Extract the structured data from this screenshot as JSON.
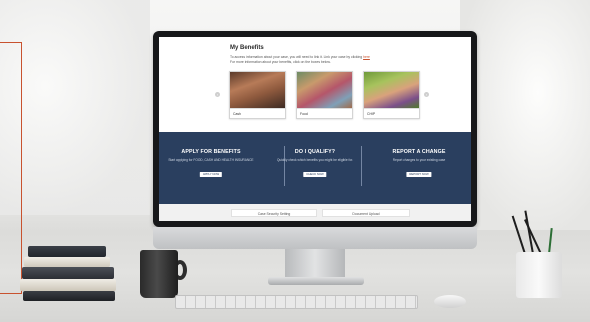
{
  "benefits": {
    "title": "My Benefits",
    "intro_line1": "To access information about your case, you will need to link it. Link your case by clicking",
    "intro_link": "here",
    "intro_line2": "For more information about your benefits, click on the boxes below.",
    "cards": [
      {
        "label": "Cash"
      },
      {
        "label": "Food"
      },
      {
        "label": "CHIP"
      }
    ]
  },
  "band": {
    "columns": [
      {
        "heading": "APPLY FOR BENEFITS",
        "text": "Start applying for FOOD, CASH AND HEALTH INSURANCE",
        "button": "APPLY NOW"
      },
      {
        "heading": "DO I QUALIFY?",
        "text": "Quickly check which benefits you might be eligible for.",
        "button": "CHECK NOW"
      },
      {
        "heading": "REPORT A CHANGE",
        "text": "Report changes to your existing case",
        "button": "REPORT NOW"
      }
    ]
  },
  "bottom": {
    "left_button": "Case Security Setting",
    "right_button": "Document Upload"
  },
  "colors": {
    "band": "#2a3f5f",
    "accent": "#c8522f"
  }
}
